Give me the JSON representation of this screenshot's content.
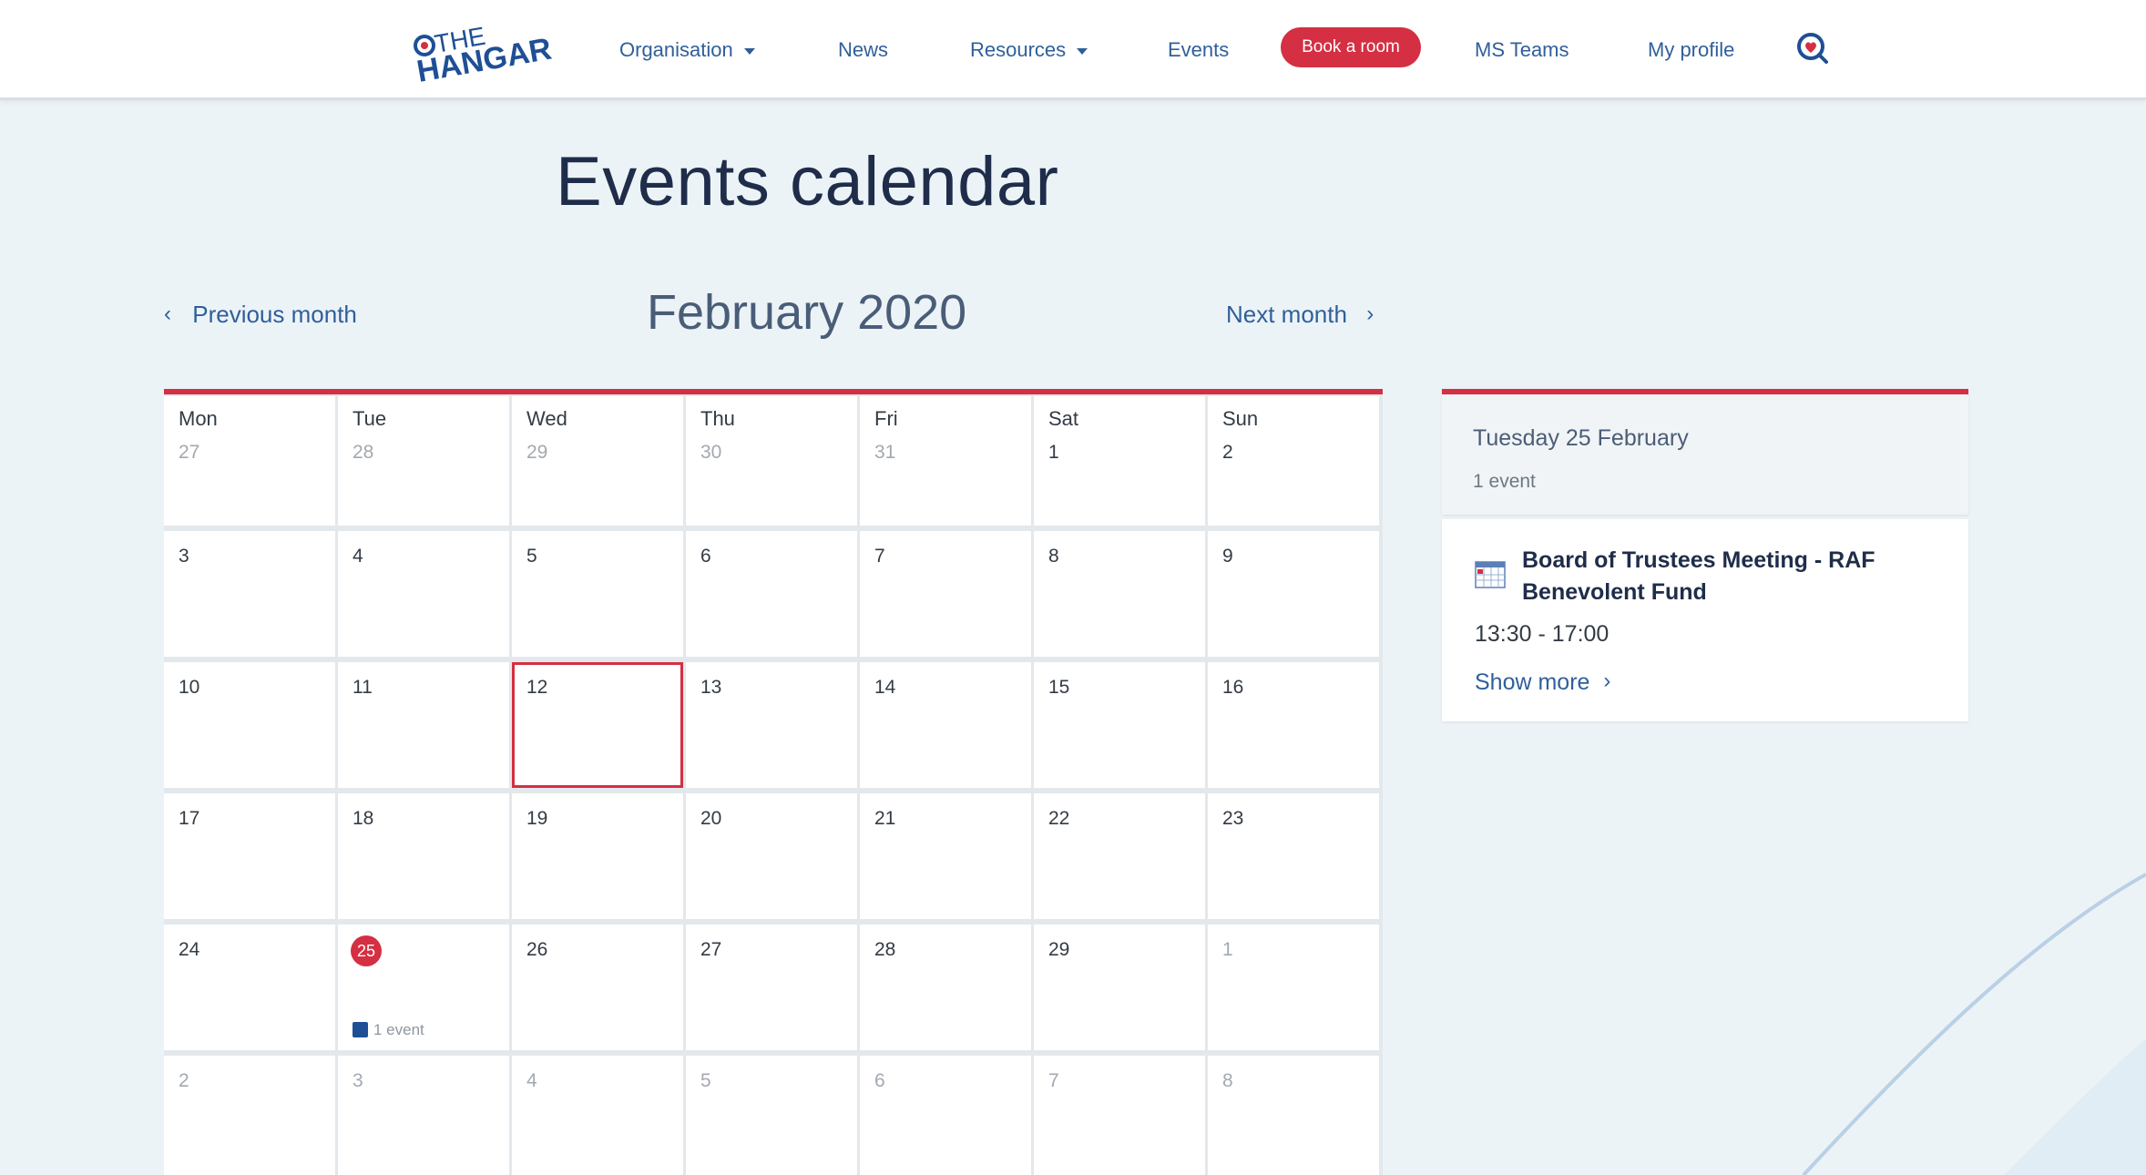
{
  "header": {
    "logo_text_top": "THE",
    "logo_text_bottom": "HANGAR",
    "nav": {
      "organisation": "Organisation",
      "news": "News",
      "resources": "Resources",
      "events": "Events",
      "book_room": "Book a room",
      "ms_teams": "MS Teams",
      "my_profile": "My profile"
    }
  },
  "page": {
    "title": "Events calendar"
  },
  "month_nav": {
    "previous": "Previous month",
    "current": "February 2020",
    "next": "Next month"
  },
  "calendar": {
    "weekdays": [
      "Mon",
      "Tue",
      "Wed",
      "Thu",
      "Fri",
      "Sat",
      "Sun"
    ],
    "weeks": [
      [
        "27",
        "28",
        "29",
        "30",
        "31",
        "1",
        "2"
      ],
      [
        "3",
        "4",
        "5",
        "6",
        "7",
        "8",
        "9"
      ],
      [
        "10",
        "11",
        "12",
        "13",
        "14",
        "15",
        "16"
      ],
      [
        "17",
        "18",
        "19",
        "20",
        "21",
        "22",
        "23"
      ],
      [
        "24",
        "25",
        "26",
        "27",
        "28",
        "29",
        "1"
      ],
      [
        "2",
        "3",
        "4",
        "5",
        "6",
        "7",
        "8"
      ]
    ],
    "event_tag": "1 event"
  },
  "side_panel": {
    "date": "Tuesday 25 February",
    "count": "1 event",
    "event": {
      "title": "Board of Trustees Meeting - RAF Benevolent Fund",
      "time": "13:30 - 17:00",
      "show_more": "Show more"
    }
  },
  "colors": {
    "accent_red": "#d42f42",
    "link_blue": "#2f5f9a",
    "event_blue": "#1e4f96",
    "page_bg": "#ecf3f7"
  }
}
